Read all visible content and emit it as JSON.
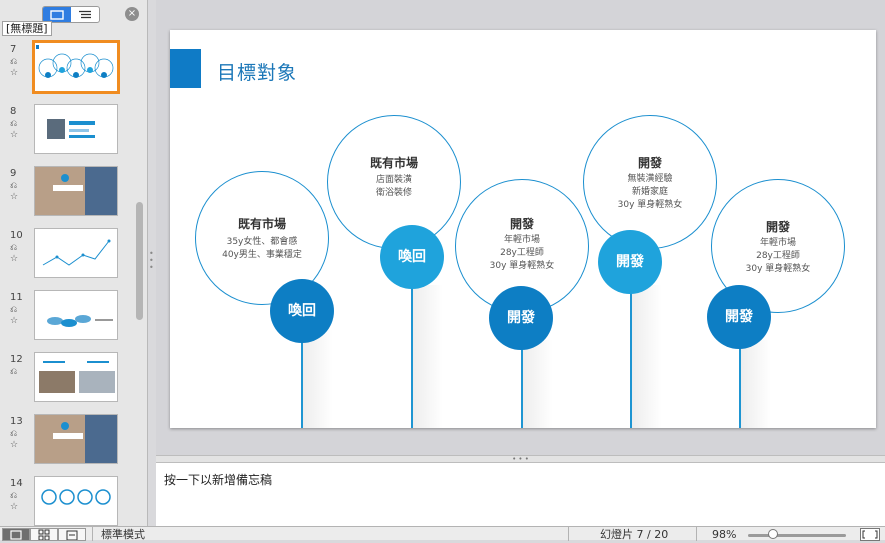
{
  "left_panel": {
    "doc_title": "[無標題]",
    "slides": [
      {
        "number": "7",
        "selected": true
      },
      {
        "number": "8",
        "selected": false
      },
      {
        "number": "9",
        "selected": false
      },
      {
        "number": "10",
        "selected": false
      },
      {
        "number": "11",
        "selected": false
      },
      {
        "number": "12",
        "selected": false
      },
      {
        "number": "13",
        "selected": false
      },
      {
        "number": "14",
        "selected": false
      }
    ]
  },
  "slide": {
    "title": "目標對象",
    "circles": [
      {
        "title": "既有市場",
        "lines": [
          "35y女性、都會感",
          "40y男生、事業穩定"
        ]
      },
      {
        "title": "既有市場",
        "lines": [
          "店面裝潢",
          "衛浴裝修"
        ]
      },
      {
        "title": "開發",
        "lines": [
          "年輕市場",
          "28y工程師",
          "30y 單身輕熟女"
        ]
      },
      {
        "title": "開發",
        "lines": [
          "無裝潢經驗",
          "新婚家庭",
          "30y 單身輕熟女"
        ]
      },
      {
        "title": "開發",
        "lines": [
          "年輕市場",
          "28y工程師",
          "30y 單身輕熟女"
        ]
      }
    ],
    "badges": [
      "喚回",
      "喚回",
      "開發",
      "開發",
      "開發"
    ],
    "colors": {
      "accent": "#0f7bc6",
      "badge_dark": "#0d7ec4",
      "badge_light": "#1fa3dc"
    }
  },
  "notes": {
    "placeholder": "按一下以新增備忘稿"
  },
  "status_bar": {
    "view_mode": "標準模式",
    "slide_position": "幻燈片 7 / 20",
    "zoom": "98%"
  }
}
